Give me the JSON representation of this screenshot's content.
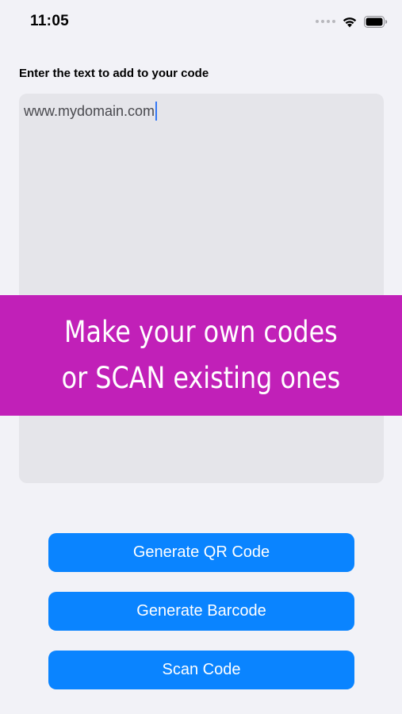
{
  "status_bar": {
    "time": "11:05",
    "icons": [
      "cellular-signal-icon",
      "wifi-icon",
      "battery-icon"
    ]
  },
  "editor": {
    "label": "Enter the text to add to your code",
    "value": "www.mydomain.com"
  },
  "promo": {
    "line1": "Make your own codes",
    "line2": "or SCAN existing ones"
  },
  "buttons": {
    "generate_qr": "Generate QR Code",
    "generate_barcode": "Generate Barcode",
    "scan_code": "Scan Code"
  },
  "colors": {
    "background": "#f2f2f7",
    "field": "#e5e5ea",
    "accent": "#0a84ff",
    "banner": "#c120b8",
    "cursor": "#3478f6"
  }
}
